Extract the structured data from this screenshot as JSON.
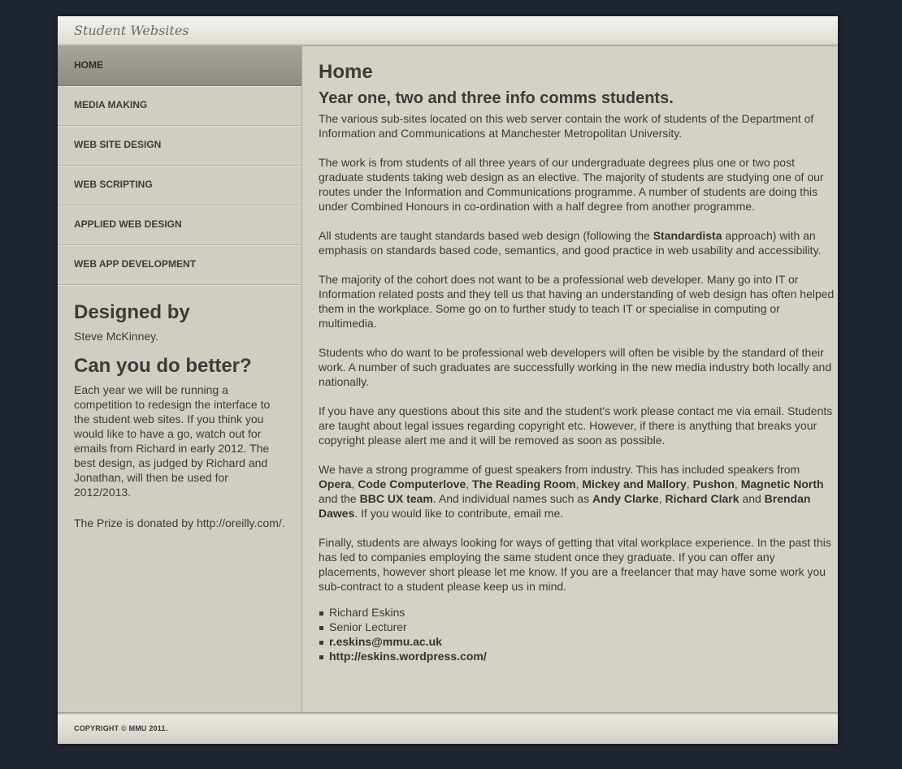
{
  "header": {
    "site_title": "Student Websites"
  },
  "nav": {
    "items": [
      {
        "label": "HOME",
        "active": true
      },
      {
        "label": "MEDIA MAKING"
      },
      {
        "label": "WEB SITE DESIGN"
      },
      {
        "label": "WEB SCRIPTING"
      },
      {
        "label": "APPLIED WEB DESIGN"
      },
      {
        "label": "WEB APP DEVELOPMENT"
      }
    ]
  },
  "sidebar": {
    "designed_heading": "Designed by",
    "designed_text": "Steve McKinney.",
    "better_heading": "Can you do better?",
    "better_text": "Each year we will be running a competition to redesign the interface to the student web sites. If you think you would like to have a go, watch out for emails from Richard in early 2012. The best design, as judged by Richard and Jonathan, will then be used for 2012/2013.",
    "prize_text": "The Prize is donated by http://oreilly.com/."
  },
  "main": {
    "title": "Home",
    "subtitle": "Year one, two and three info comms students.",
    "p1": "The various sub-sites located on this web server contain the work of students of the Department of Information and Communications at Manchester Metropolitan University.",
    "p2": "The work is from students of all three years of our undergraduate degrees plus one or two post graduate students taking web design as an elective. The majority of students are studying one of our routes under the Information and Communications programme. A number of students are doing this under Combined Honours in co-ordination with a half degree from another programme.",
    "p3_a": "All students are taught standards based web design (following the ",
    "p3_b": "Standardista",
    "p3_c": " approach) with an emphasis on standards based code, semantics, and good practice in web usability and accessibility.",
    "p4": "The majority of the cohort does not want to be a professional web developer. Many go into IT or Information related posts and they tell us that having an understanding of web design has often helped them in the workplace. Some go on to further study to teach IT or specialise in computing or multimedia.",
    "p5": "Students who do want to be professional web developers will often be visible by the standard of their work. A number of such graduates are successfully working in the new media industry both locally and nationally.",
    "p6": "If you have any questions about this site and the student's work please contact me via email. Students are taught about legal issues regarding copyright etc. However, if there is anything that breaks your copyright please alert me and it will be removed as soon as possible.",
    "p7": {
      "t1": "We have a strong programme of guest speakers from industry. This has included speakers from ",
      "opera": "Opera",
      "sep1": ", ",
      "code": "Code Computerlove",
      "sep2": ", ",
      "reading": "The Reading Room",
      "sep3": ", ",
      "mickey": "Mickey and Mallory",
      "sep4": ", ",
      "pushon": "Pushon",
      "sep5": ", ",
      "magnetic": "Magnetic North",
      "t2": " and the ",
      "bbc": "BBC UX team",
      "t3": ". And individual names such as ",
      "andy": "Andy Clarke",
      "sep6": ", ",
      "richard": "Richard Clark",
      "t4": " and ",
      "brendan": "Brendan Dawes",
      "t5": ". If you would like to contribute, email me."
    },
    "p8": "Finally, students are always looking for ways of getting that vital workplace experience. In the past this has led to companies employing the same student once they graduate. If you can offer any placements, however short please let me know. If you are a freelancer that may have some work you sub-contract to a student please keep us in mind.",
    "contact": {
      "name": "Richard Eskins",
      "role": "Senior Lecturer",
      "email": "r.eskins@mmu.ac.uk",
      "blog": "http://eskins.wordpress.com/"
    }
  },
  "footer": {
    "copyright": "COPYRIGHT © MMU 2011."
  }
}
